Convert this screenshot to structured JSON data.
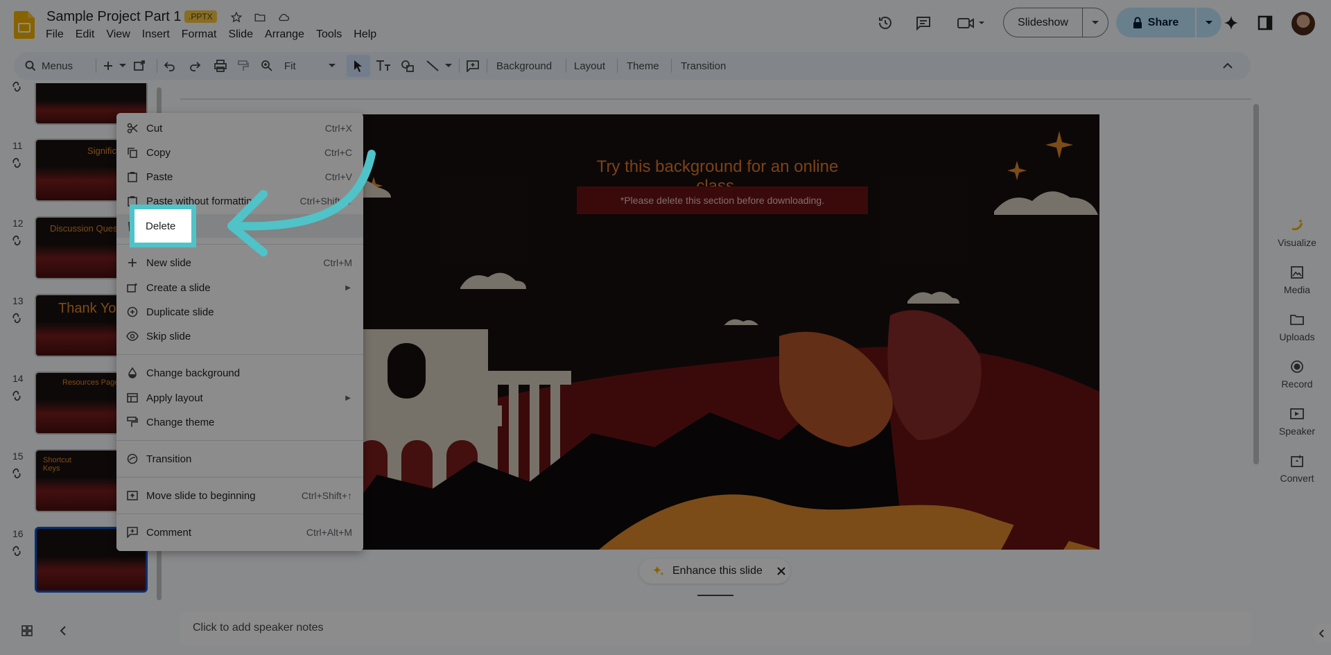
{
  "app": {
    "doc_title": "Sample Project Part 1",
    "file_badge": ".PPTX",
    "menu": [
      "File",
      "Edit",
      "View",
      "Insert",
      "Format",
      "Slide",
      "Arrange",
      "Tools",
      "Help"
    ]
  },
  "header": {
    "slideshow_label": "Slideshow",
    "share_label": "Share"
  },
  "toolbar": {
    "search_label": "Menus",
    "zoom_label": "Fit",
    "background_label": "Background",
    "layout_label": "Layout",
    "theme_label": "Theme",
    "transition_label": "Transition"
  },
  "filmstrip": {
    "slides": [
      {
        "num": "11",
        "title": "Signific"
      },
      {
        "num": "12",
        "title": "Discussion Quest"
      },
      {
        "num": "13",
        "title": "Thank You"
      },
      {
        "num": "14",
        "title": "Resources Page"
      },
      {
        "num": "15",
        "title": "Shortcut Keys"
      },
      {
        "num": "16",
        "title": ""
      }
    ]
  },
  "slide": {
    "title": "Try this background for an online class.",
    "note": "*Please delete this section before downloading."
  },
  "enhance": {
    "label": "Enhance this slide"
  },
  "notes": {
    "placeholder": "Click to add speaker notes"
  },
  "side_panel": {
    "items": [
      "Visualize",
      "Media",
      "Uploads",
      "Record",
      "Speaker",
      "Convert"
    ]
  },
  "context_menu": {
    "items": [
      {
        "label": "Cut",
        "shortcut": "Ctrl+X"
      },
      {
        "label": "Copy",
        "shortcut": "Ctrl+C"
      },
      {
        "label": "Paste",
        "shortcut": "Ctrl+V"
      },
      {
        "label": "Paste without formatting",
        "shortcut": "Ctrl+Shift+V"
      },
      {
        "label": "Delete",
        "shortcut": ""
      },
      {
        "label": "New slide",
        "shortcut": "Ctrl+M"
      },
      {
        "label": "Create a slide",
        "shortcut": ""
      },
      {
        "label": "Duplicate slide",
        "shortcut": ""
      },
      {
        "label": "Skip slide",
        "shortcut": ""
      },
      {
        "label": "Change background",
        "shortcut": ""
      },
      {
        "label": "Apply layout",
        "shortcut": ""
      },
      {
        "label": "Change theme",
        "shortcut": ""
      },
      {
        "label": "Transition",
        "shortcut": ""
      },
      {
        "label": "Move slide to beginning",
        "shortcut": "Ctrl+Shift+↑"
      },
      {
        "label": "Comment",
        "shortcut": "Ctrl+Alt+M"
      }
    ]
  },
  "colors": {
    "accent": "#0b57d0",
    "highlight": "#4fc3c8",
    "slide_title": "#e0782a",
    "slide_bg": "#181010"
  }
}
